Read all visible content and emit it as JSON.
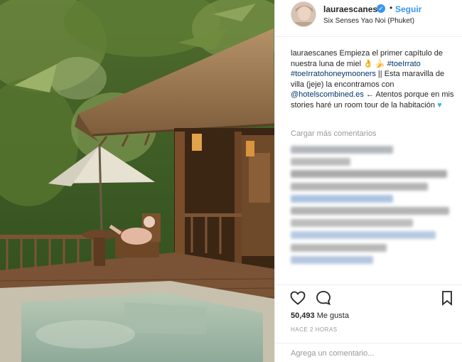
{
  "post": {
    "username": "lauraescanes",
    "separator": "•",
    "follow_label": "Seguir",
    "location": "Six Senses Yao Noi (Phuket)"
  },
  "caption": {
    "author": "lauraescanes",
    "line1": "Empieza el primer capítulo de nuestra luna de miel",
    "emoji1": "👌",
    "emoji2": "🍌",
    "tag1": "#toeIrrato",
    "tag2": "#toeIrratohoneymooners",
    "text2": "|| Esta maravilla de villa (jeje) la encontramos con",
    "mention": "@hotelscombined.es",
    "text3": "← Atentos porque en mis stories haré un room tour de la habitación",
    "heart": "♥"
  },
  "comments": {
    "load_more": "Cargar más comentarios",
    "blurred_lines": [
      {
        "width": 0.62,
        "color": "#9aa0a6"
      },
      {
        "width": 0.36,
        "color": "#a5a5a5"
      },
      {
        "width": 0.95,
        "color": "#8e8e8e"
      },
      {
        "width": 0.83,
        "color": "#9c9c9c"
      },
      {
        "width": 0.62,
        "color": "#8fb0d8"
      },
      {
        "width": 0.96,
        "color": "#9a9a9a"
      },
      {
        "width": 0.74,
        "color": "#a7a7a7"
      },
      {
        "width": 0.88,
        "color": "#9fb8d8"
      },
      {
        "width": 0.58,
        "color": "#a0a0a0"
      },
      {
        "width": 0.5,
        "color": "#9cb3d4"
      }
    ]
  },
  "actions": {
    "like_icon": "heart-outline-icon",
    "comment_icon": "speech-bubble-icon",
    "save_icon": "bookmark-icon"
  },
  "stats": {
    "likes_count": "50,493",
    "likes_label": "Me gusta",
    "time": "HACE 2 HORAS"
  },
  "composer": {
    "placeholder": "Agrega un comentario..."
  },
  "colors": {
    "accent": "#3897f0",
    "muted": "#999999",
    "link": "#003569"
  }
}
